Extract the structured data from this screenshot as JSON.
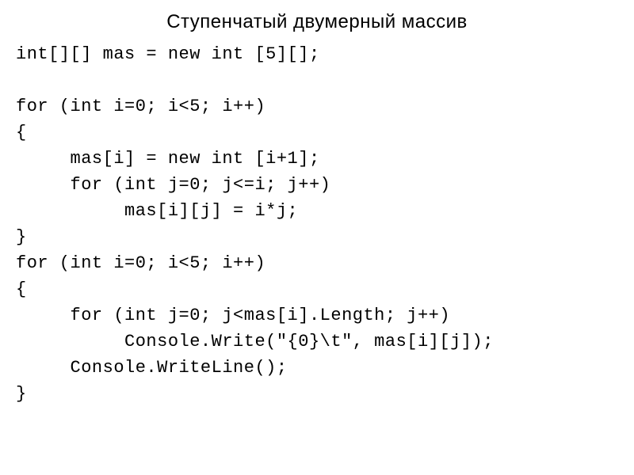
{
  "title": "Ступенчатый двумерный массив",
  "code": {
    "line1": "int[][] mas = new int [5][];",
    "line2": "for (int i=0; i<5; i++)",
    "line3": "{",
    "line4": "     mas[i] = new int [i+1];",
    "line5": "     for (int j=0; j<=i; j++)",
    "line6": "          mas[i][j] = i*j;",
    "line7": "}",
    "line8": "for (int i=0; i<5; i++)",
    "line9": "{",
    "line10": "     for (int j=0; j<mas[i].Length; j++)",
    "line11": "          Console.Write(\"{0}\\t\", mas[i][j]);",
    "line12": "     Console.WriteLine();",
    "line13": "}"
  }
}
